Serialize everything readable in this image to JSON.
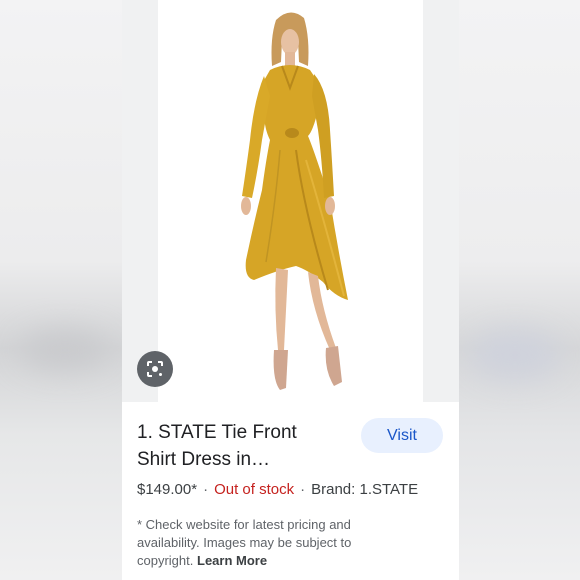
{
  "product": {
    "title": "1. STATE Tie Front Shirt Dress in…",
    "price": "$149.00*",
    "stock_status": "Out of stock",
    "brand": "Brand: 1.STATE",
    "separator": "·"
  },
  "actions": {
    "visit_label": "Visit"
  },
  "disclaimer": {
    "text": "* Check website for latest pricing and availability. Images may be subject to copyright.",
    "learn_more": "Learn More"
  },
  "image": {
    "icon": "lens-icon",
    "dress_color": "#d6a526"
  },
  "colors": {
    "out_of_stock": "#c5221f",
    "visit_bg": "#e8f0fe",
    "visit_text": "#1a56c8"
  }
}
